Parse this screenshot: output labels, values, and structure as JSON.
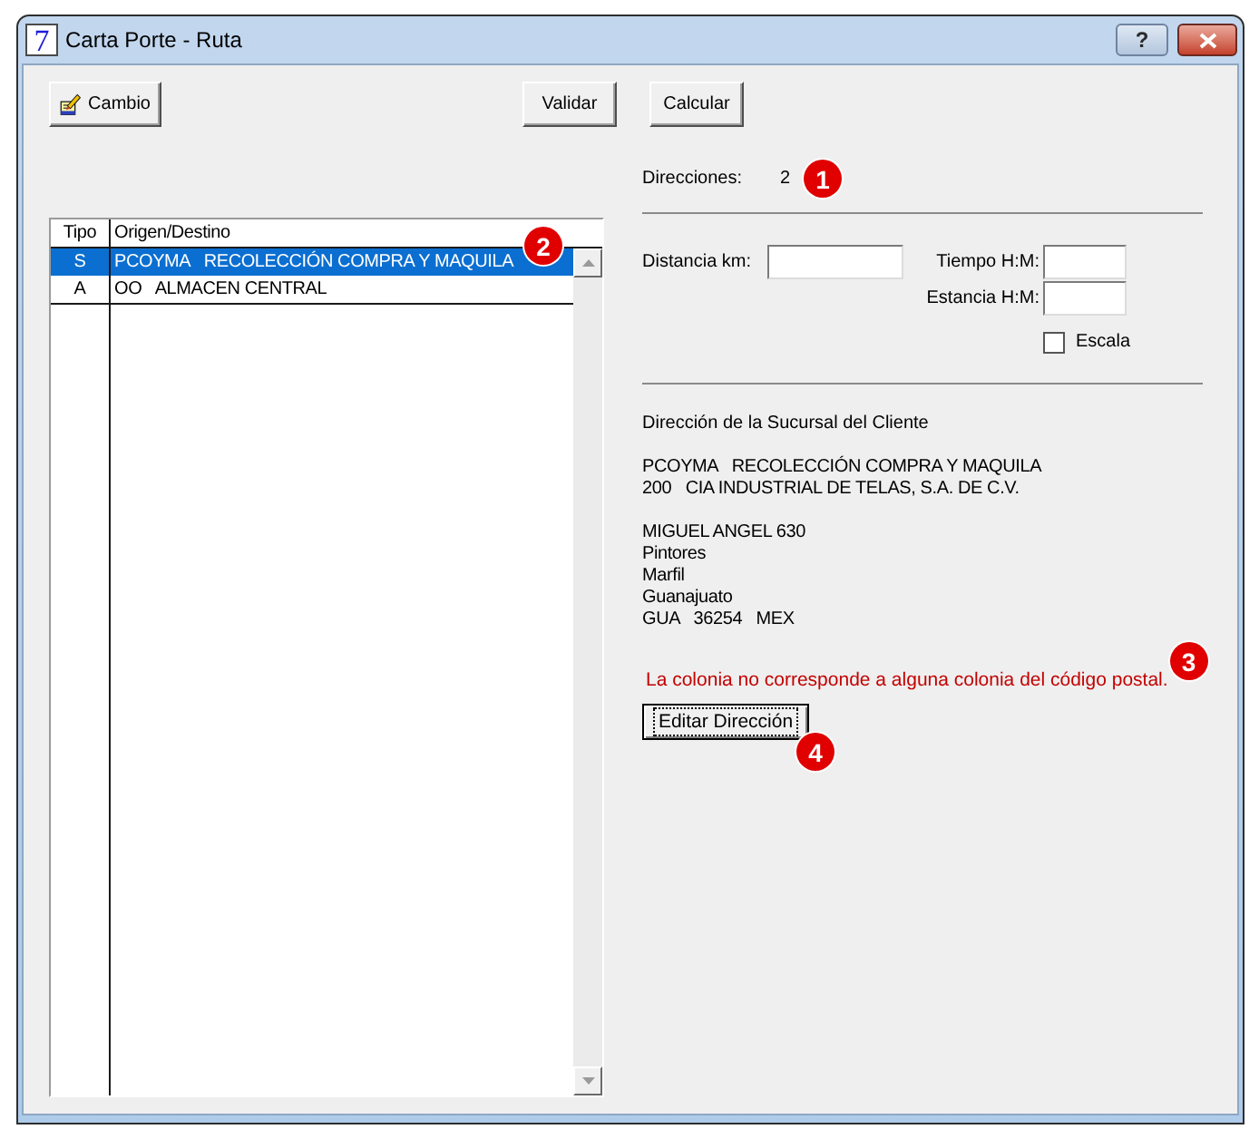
{
  "window": {
    "app_icon": "7",
    "title": "Carta Porte - Ruta",
    "help_button": "?"
  },
  "toolbar": [
    {
      "label": "Cambio",
      "kind": "icon"
    },
    {
      "label": "Validar",
      "kind": "text"
    },
    {
      "label": "Calcular",
      "kind": "text"
    }
  ],
  "route_list": {
    "columns": [
      "Tipo",
      "Origen/Destino"
    ],
    "rows": [
      {
        "tipo": "S",
        "origen_destino": "PCOYMA   RECOLECCIÓN COMPRA Y MAQUILA",
        "selected": true
      },
      {
        "tipo": "A",
        "origen_destino": "OO   ALMACEN CENTRAL",
        "selected": false
      }
    ],
    "callout": "2"
  },
  "summary": {
    "label": "Direcciones:",
    "value": "2",
    "callout": "1"
  },
  "time_fields": [
    {
      "label": "Distancia km:"
    },
    {
      "label": "Tiempo H:M:"
    },
    {
      "label": "Estancia H:M:"
    }
  ],
  "scale_checkbox": {
    "label": "Escala",
    "checked": false
  },
  "address": {
    "heading": "Dirección de la Sucursal del Cliente",
    "blocks": [
      [
        "PCOYMA   RECOLECCIÓN COMPRA Y MAQUILA",
        "200   CIA INDUSTRIAL DE TELAS, S.A. DE C.V."
      ],
      [
        "MIGUEL ANGEL 630",
        "Pintores",
        "Marfil",
        "Guanajuato",
        "GUA   36254   MEX"
      ]
    ]
  },
  "warning": {
    "text": "La colonia no corresponde a alguna colonia del código postal.",
    "callout": "3"
  },
  "edit_button": {
    "label": "Editar Dirección",
    "focused": true,
    "callout": "4"
  }
}
